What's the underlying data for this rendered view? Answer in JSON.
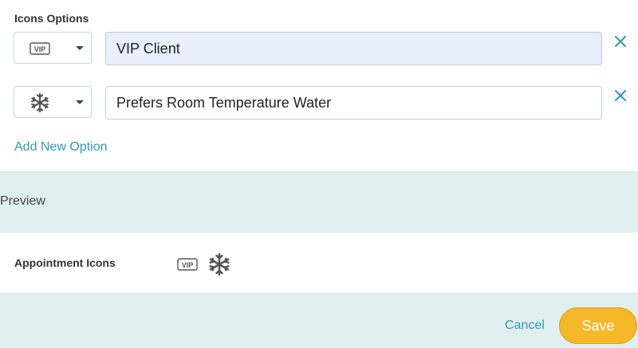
{
  "icons_options": {
    "title": "Icons Options",
    "options": [
      {
        "icon": "vip-icon",
        "value": "VIP Client"
      },
      {
        "icon": "snowflake-icon",
        "value": "Prefers Room Temperature Water"
      }
    ],
    "add_label": "Add New Option"
  },
  "preview": {
    "label": "Preview",
    "row_label": "Appointment Icons",
    "icons": [
      "vip-icon",
      "snowflake-icon"
    ]
  },
  "footer": {
    "cancel_label": "Cancel",
    "save_label": "Save"
  },
  "colors": {
    "accent": "#2f9aaa",
    "save": "#f5b82a",
    "background": "#e1eff1",
    "input_filled": "#e8f0fd"
  },
  "vip_badge_text": "VIP"
}
